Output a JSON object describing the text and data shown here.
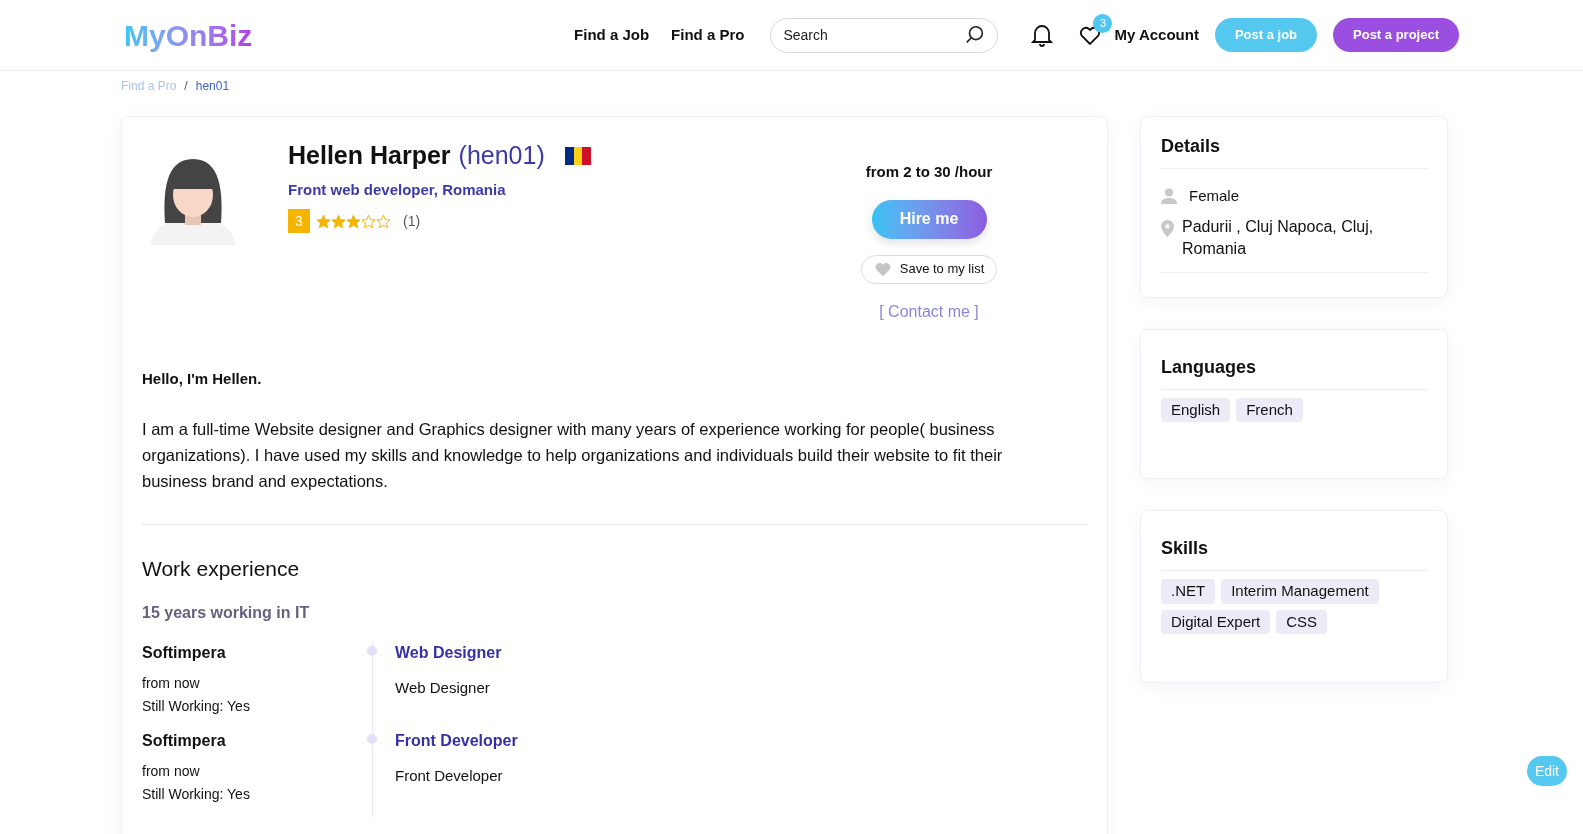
{
  "header": {
    "logo": "MyOnBiz",
    "nav": [
      "Find a Job",
      "Find a Pro"
    ],
    "search": {
      "placeholder": "Search"
    },
    "favorites_count": "3",
    "account": "My Account",
    "post_job": "Post a job",
    "post_project": "Post a project"
  },
  "breadcrumb": {
    "separator": "/",
    "items": [
      {
        "label": "Find a Pro",
        "selected": false
      },
      {
        "label": "hen01",
        "selected": true
      }
    ]
  },
  "profile": {
    "name": "Hellen Harper",
    "username": "(hen01)",
    "subtitle": "Front web developer, Romania",
    "rating": "3",
    "stars": 3,
    "reviews": "(1)",
    "rate": "from 2 to 30 /hour",
    "hire": "Hire me",
    "save": "Save to my list",
    "contact": "[ Contact me ]"
  },
  "about": {
    "greeting": "Hello, I'm Hellen.",
    "text": "I am a full-time Website designer and Graphics designer with many years of experience working for people( business organizations). I have used my skills and knowledge to help organizations and individuals build their website to fit their business brand and expectations."
  },
  "work": {
    "title": "Work experience",
    "summary": "15 years working in IT",
    "items": [
      {
        "company": "Softimpera",
        "period": "from now",
        "still": "Still Working: Yes",
        "role": "Web Designer",
        "description": "Web Designer"
      },
      {
        "company": "Softimpera",
        "period": "from now",
        "still": "Still Working: Yes",
        "role": "Front Developer",
        "description": "Front Developer"
      }
    ]
  },
  "details": {
    "title": "Details",
    "gender": "Female",
    "address": "Padurii , Cluj Napoca, Cluj, Romania"
  },
  "languages": {
    "title": "Languages",
    "items": [
      "English",
      "French"
    ]
  },
  "skills": {
    "title": "Skills",
    "items": [
      ".NET",
      "Interim Management",
      "Digital Expert",
      "CSS"
    ]
  },
  "edit": "Edit"
}
